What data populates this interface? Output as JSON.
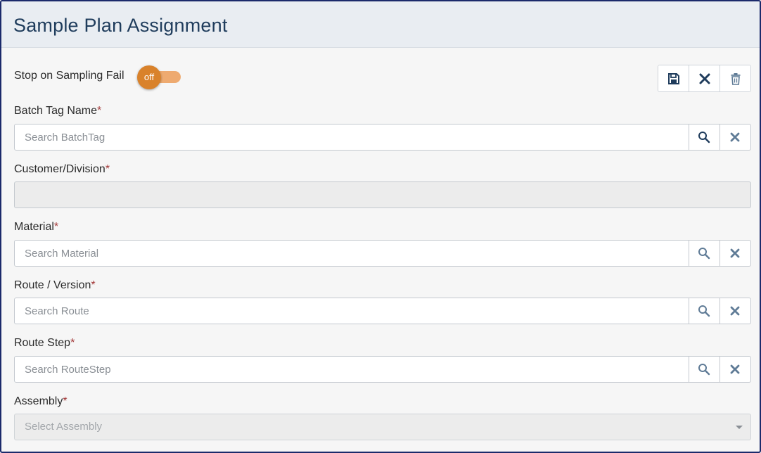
{
  "header": {
    "title": "Sample Plan Assignment"
  },
  "toggle": {
    "label": "Stop on Sampling Fail",
    "state_text": "off",
    "checked": false,
    "knob_color": "#d9822b",
    "track_color": "#eeaa70"
  },
  "actions": [
    {
      "name": "save-icon"
    },
    {
      "name": "close-icon"
    },
    {
      "name": "trash-icon"
    }
  ],
  "fields": {
    "batch_tag": {
      "label": "Batch Tag Name",
      "required_mark": "*",
      "placeholder": "Search BatchTag",
      "value": ""
    },
    "customer": {
      "label": "Customer/Division",
      "required_mark": "*",
      "value": ""
    },
    "material": {
      "label": "Material",
      "required_mark": "*",
      "placeholder": "Search Material",
      "value": ""
    },
    "route": {
      "label": "Route / Version",
      "required_mark": "*",
      "placeholder": "Search Route",
      "value": ""
    },
    "route_step": {
      "label": "Route Step",
      "required_mark": "*",
      "placeholder": "Search RouteStep",
      "value": ""
    },
    "assembly": {
      "label": "Assembly",
      "required_mark": "*",
      "placeholder": "Select Assembly"
    }
  },
  "colors": {
    "accent": "#1f3c5c",
    "required": "#a33a3a",
    "icon": "#1f3c5c"
  }
}
